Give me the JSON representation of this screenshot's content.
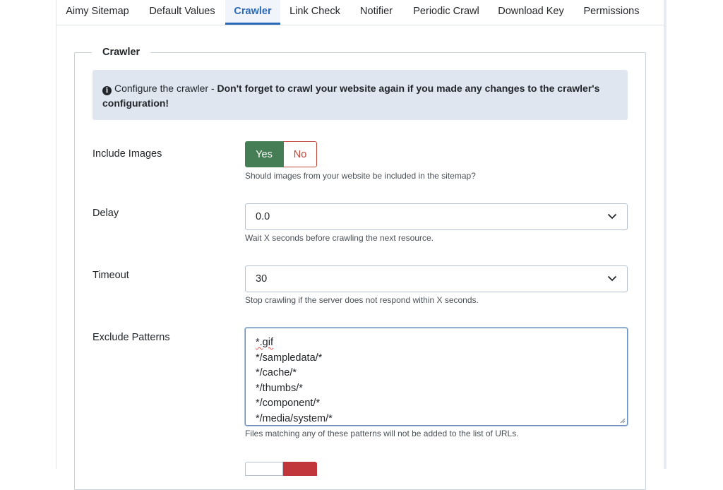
{
  "tabs": [
    {
      "label": "Aimy Sitemap"
    },
    {
      "label": "Default Values"
    },
    {
      "label": "Crawler"
    },
    {
      "label": "Link Check"
    },
    {
      "label": "Notifier"
    },
    {
      "label": "Periodic Crawl"
    },
    {
      "label": "Download Key"
    },
    {
      "label": "Permissions"
    }
  ],
  "fieldset": {
    "legend": "Crawler"
  },
  "alert": {
    "prefix": "Configure the crawler - ",
    "bold": "Don't forget to crawl your website again if you made any changes to the crawler's configuration!"
  },
  "include_images": {
    "label": "Include Images",
    "yes": "Yes",
    "no": "No",
    "selected": "Yes",
    "help": "Should images from your website be included in the sitemap?"
  },
  "delay": {
    "label": "Delay",
    "value": "0.0",
    "help": "Wait X seconds before crawling the next resource."
  },
  "timeout": {
    "label": "Timeout",
    "value": "30",
    "help": "Stop crawling if the server does not respond within X seconds."
  },
  "exclude_patterns": {
    "label": "Exclude Patterns",
    "lines": [
      "*.gif",
      "*/sampledata/*",
      "*/cache/*",
      "*/thumbs/*",
      "*/component/*",
      "*/media/system/*"
    ],
    "help": "Files matching any of these patterns will not be added to the list of URLs."
  },
  "colors": {
    "active_tab": "#2a69b8",
    "yes_green": "#457d54",
    "no_red": "#c1463a",
    "alert_bg": "#dfe6f0"
  }
}
